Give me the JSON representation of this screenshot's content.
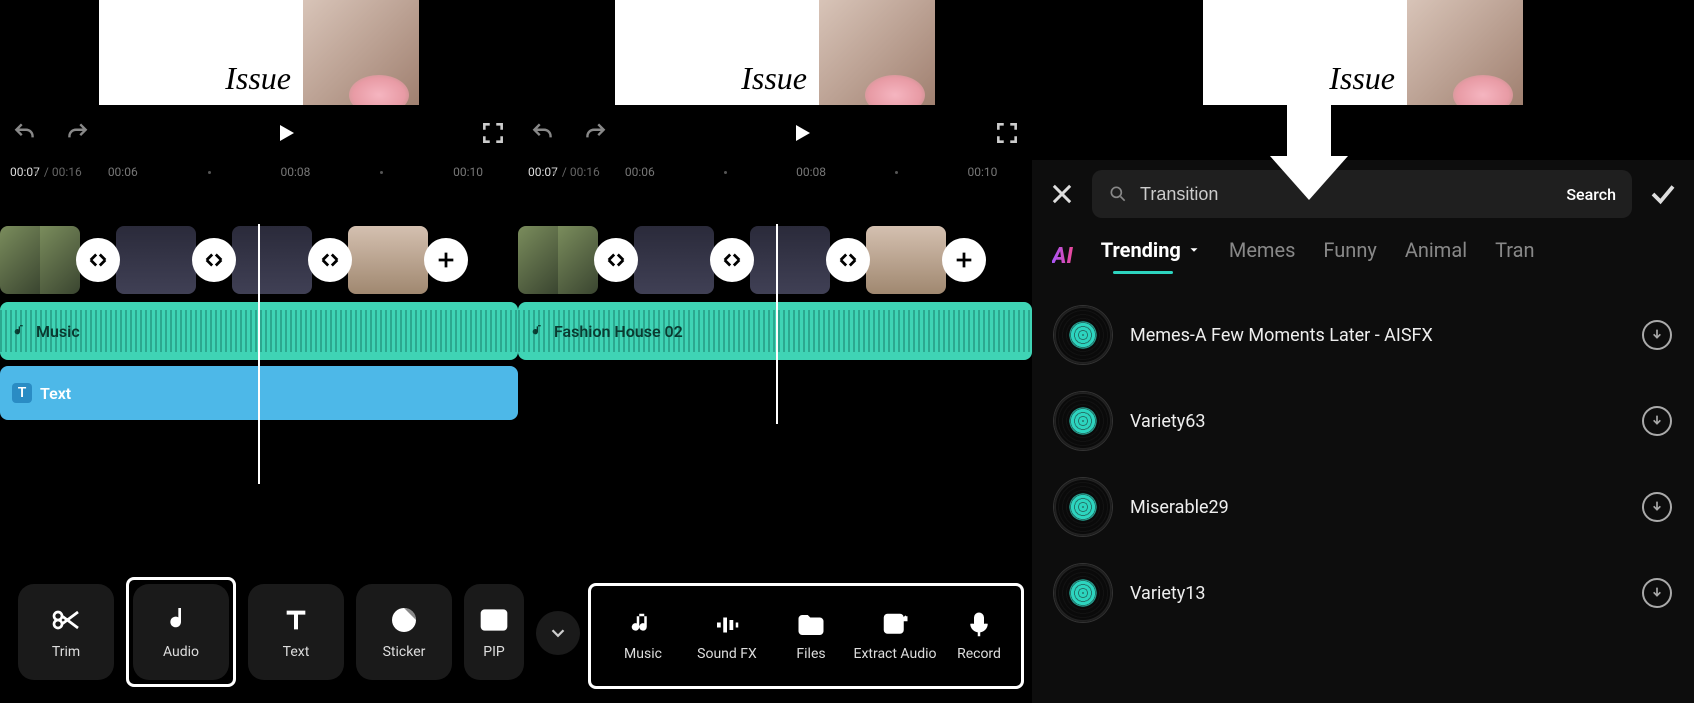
{
  "preview": {
    "issue_text": "Issue"
  },
  "playback": {
    "current": "00:07",
    "duration": "00:16"
  },
  "ruler_marks": [
    "00:06",
    "00:08",
    "00:10"
  ],
  "tracks": {
    "screen1_audio": "Music",
    "screen1_text": "Text",
    "screen2_audio": "Fashion House 02"
  },
  "tools_main": [
    {
      "id": "trim",
      "label": "Trim"
    },
    {
      "id": "audio",
      "label": "Audio"
    },
    {
      "id": "text",
      "label": "Text"
    },
    {
      "id": "sticker",
      "label": "Sticker"
    },
    {
      "id": "pip",
      "label": "PIP"
    }
  ],
  "tools_audio_sub": [
    {
      "id": "music",
      "label": "Music"
    },
    {
      "id": "soundfx",
      "label": "Sound FX"
    },
    {
      "id": "files",
      "label": "Files"
    },
    {
      "id": "extract",
      "label": "Extract Audio"
    },
    {
      "id": "record",
      "label": "Record"
    }
  ],
  "music_panel": {
    "search_value": "Transition",
    "search_btn": "Search",
    "ai_label": "AI",
    "categories": [
      {
        "label": "Trending",
        "active": true,
        "dropdown": true
      },
      {
        "label": "Memes"
      },
      {
        "label": "Funny"
      },
      {
        "label": "Animal"
      },
      {
        "label": "Tran"
      }
    ],
    "tracks": [
      {
        "name": "Memes-A Few Moments Later - AISFX"
      },
      {
        "name": "Variety63"
      },
      {
        "name": "Miserable29"
      },
      {
        "name": "Variety13"
      }
    ]
  }
}
